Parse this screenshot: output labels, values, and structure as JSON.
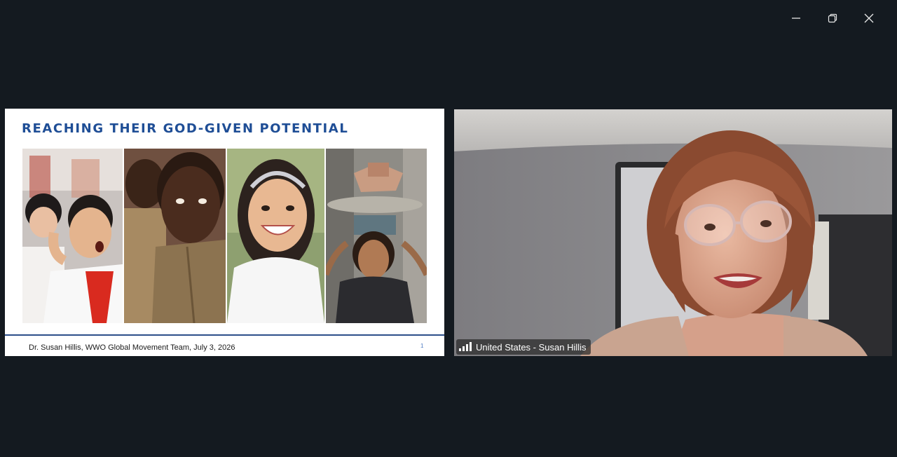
{
  "window_controls": {
    "minimize_icon": "minimize-icon",
    "restore_icon": "restore-icon",
    "close_icon": "close-icon"
  },
  "slide": {
    "title": "REACHING THEIR GOD-GIVEN POTENTIAL",
    "footer": "Dr. Susan Hillis, WWO Global Movement Team, July 3, 2026",
    "page_number": "1",
    "title_color": "#1f4e96"
  },
  "video": {
    "participant_label": "United States - Susan Hillis",
    "signal_icon": "signal-strength-icon"
  }
}
